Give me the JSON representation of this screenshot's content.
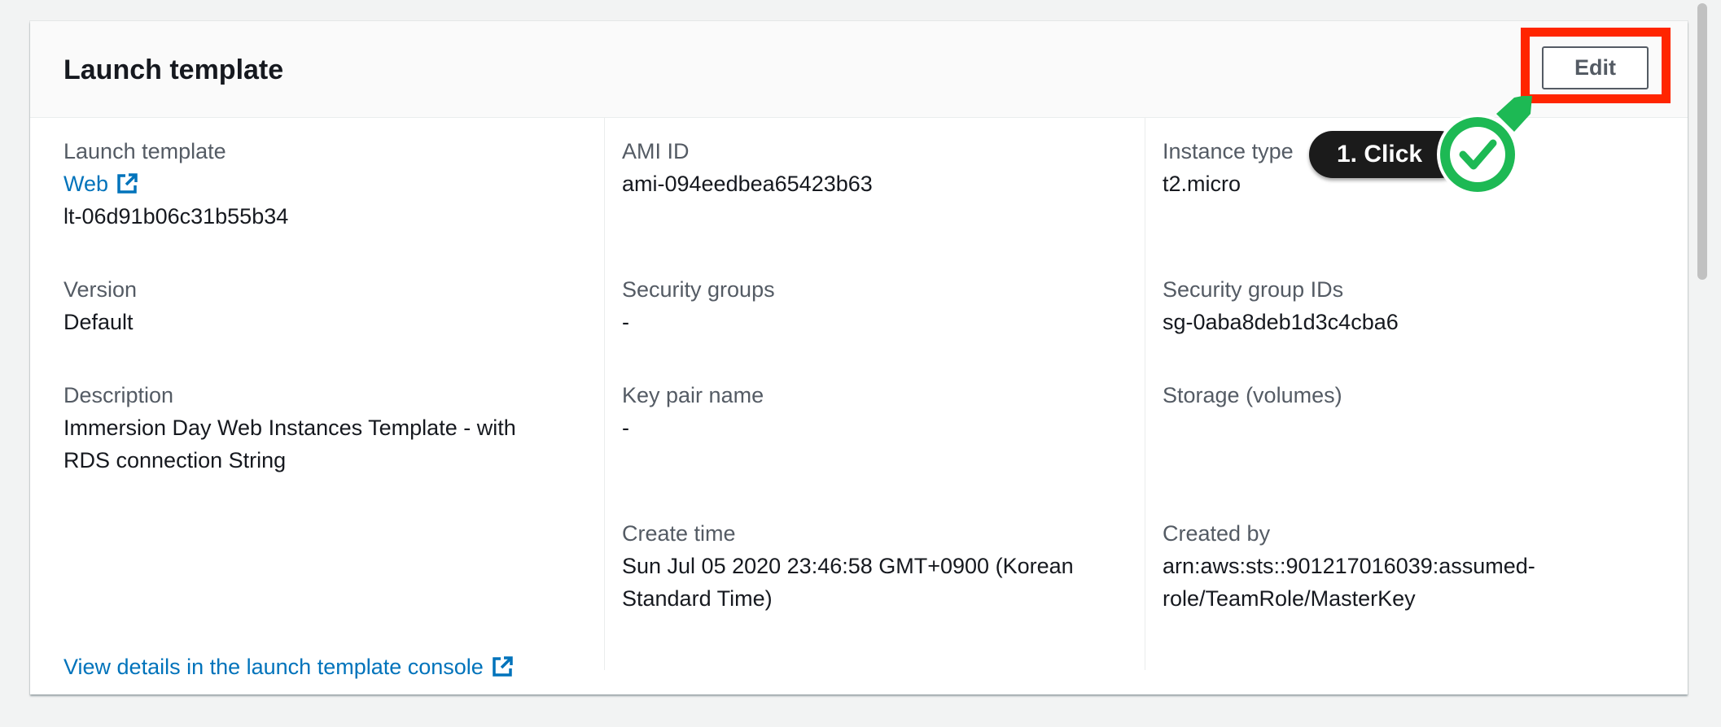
{
  "panel": {
    "title": "Launch template",
    "edit_label": "Edit"
  },
  "columns": [
    {
      "fields": [
        {
          "label": "Launch template",
          "link": "Web",
          "value": "lt-06d91b06c31b55b34"
        },
        {
          "label": "Version",
          "value": "Default"
        },
        {
          "label": "Description",
          "value_lines": [
            "Immersion Day Web Instances Template - with",
            "RDS connection String"
          ]
        }
      ]
    },
    {
      "fields": [
        {
          "label": "AMI ID",
          "value": "ami-094eedbea65423b63"
        },
        {
          "label": "Security groups",
          "value": "-"
        },
        {
          "label": "Key pair name",
          "value": "-"
        },
        {
          "label": "Create time",
          "value_lines": [
            "Sun Jul 05 2020 23:46:58 GMT+0900 (Korean",
            "Standard Time)"
          ]
        }
      ]
    },
    {
      "fields": [
        {
          "label": "Instance type",
          "value": "t2.micro"
        },
        {
          "label": "Security group IDs",
          "value": "sg-0aba8deb1d3c4cba6"
        },
        {
          "label": "Storage (volumes)",
          "value": ""
        },
        {
          "label": "Created by",
          "value_lines": [
            "arn:aws:sts::901217016039:assumed-",
            "role/TeamRole/MasterKey"
          ]
        }
      ]
    }
  ],
  "footer_link": "View details in the launch template console",
  "annotation": {
    "tooltip_text": "1. Click",
    "highlight_color": "#ff2500",
    "check_color": "#1db954"
  },
  "colors": {
    "link": "#0073bb",
    "label": "#545b64",
    "text": "#16191f",
    "background": "#f2f3f3"
  },
  "icons": [
    "external-link-icon",
    "check-icon"
  ]
}
